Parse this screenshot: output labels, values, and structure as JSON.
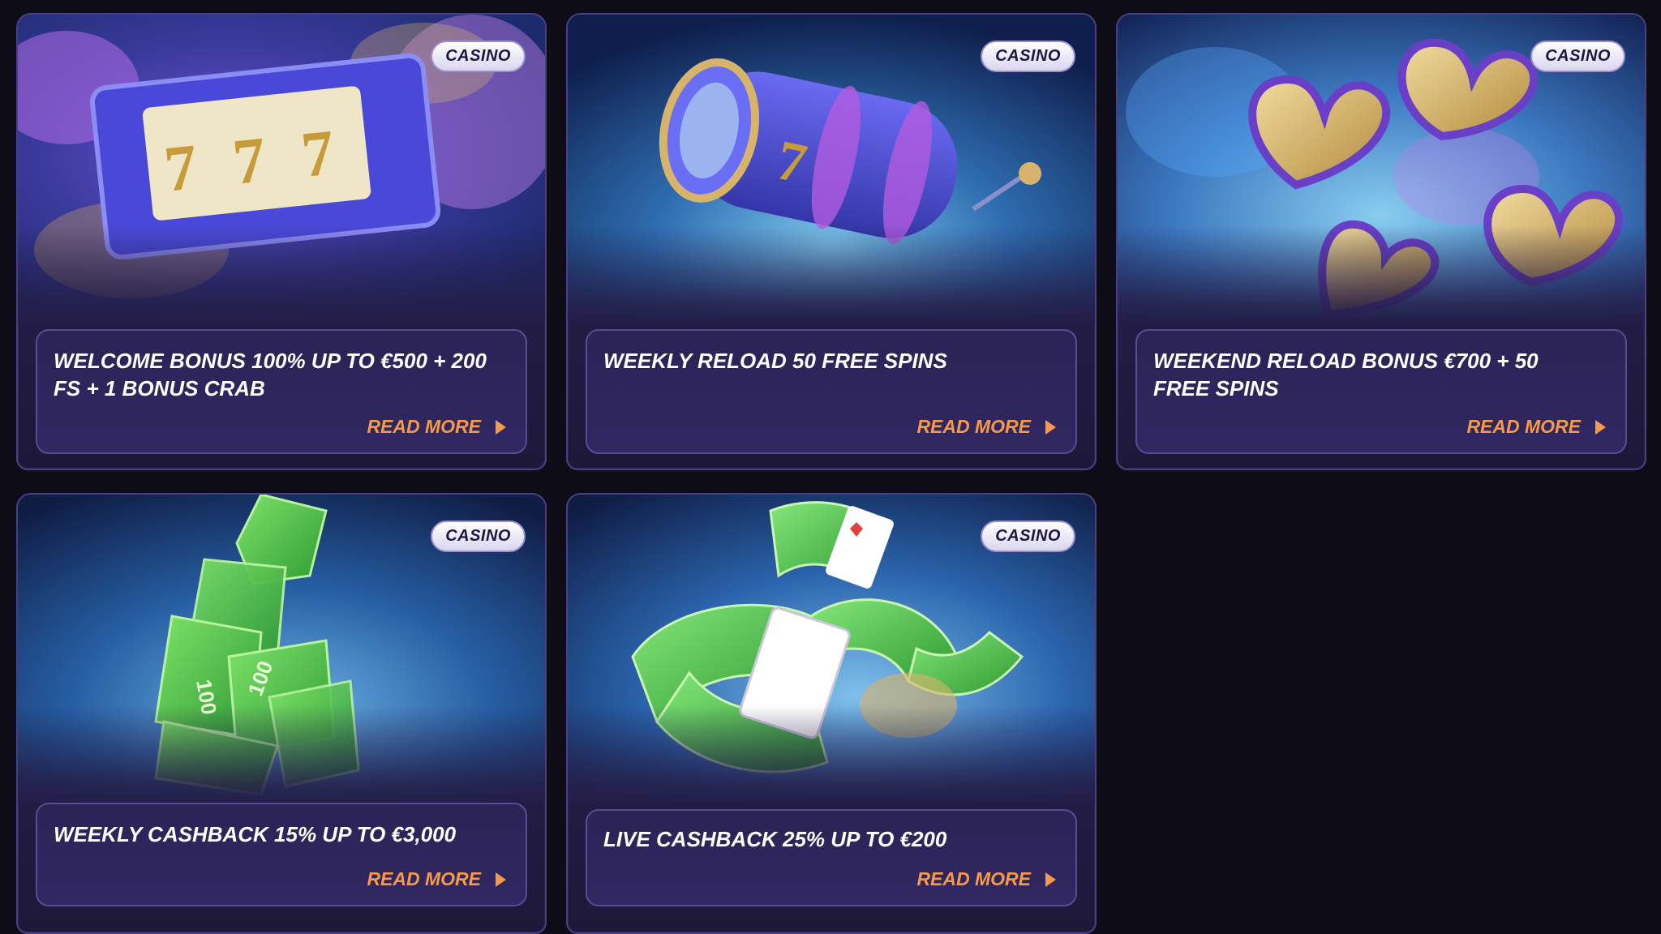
{
  "promotions": [
    {
      "badge": "CASINO",
      "title": "WELCOME BONUS 100% UP TO €500 + 200 FS + 1 BONUS CRAB",
      "cta": "READ MORE",
      "art": "slot-machine"
    },
    {
      "badge": "CASINO",
      "title": "WEEKLY RELOAD 50 FREE SPINS",
      "cta": "READ MORE",
      "art": "slot-reel"
    },
    {
      "badge": "CASINO",
      "title": "WEEKEND RELOAD BONUS €700 + 50 FREE SPINS",
      "cta": "READ MORE",
      "art": "golden-hearts"
    },
    {
      "badge": "CASINO",
      "title": "WEEKLY CASHBACK 15% UP TO €3,000",
      "cta": "READ MORE",
      "art": "money-swirl"
    },
    {
      "badge": "CASINO",
      "title": "LIVE CASHBACK 25% UP TO €200",
      "cta": "READ MORE",
      "art": "cards-and-money"
    }
  ],
  "colors": {
    "page_background": "#0e0c17",
    "card_background": "#241d47",
    "card_border": "#4a3f86",
    "cta": "#f59a4a",
    "title": "#ffffff"
  }
}
